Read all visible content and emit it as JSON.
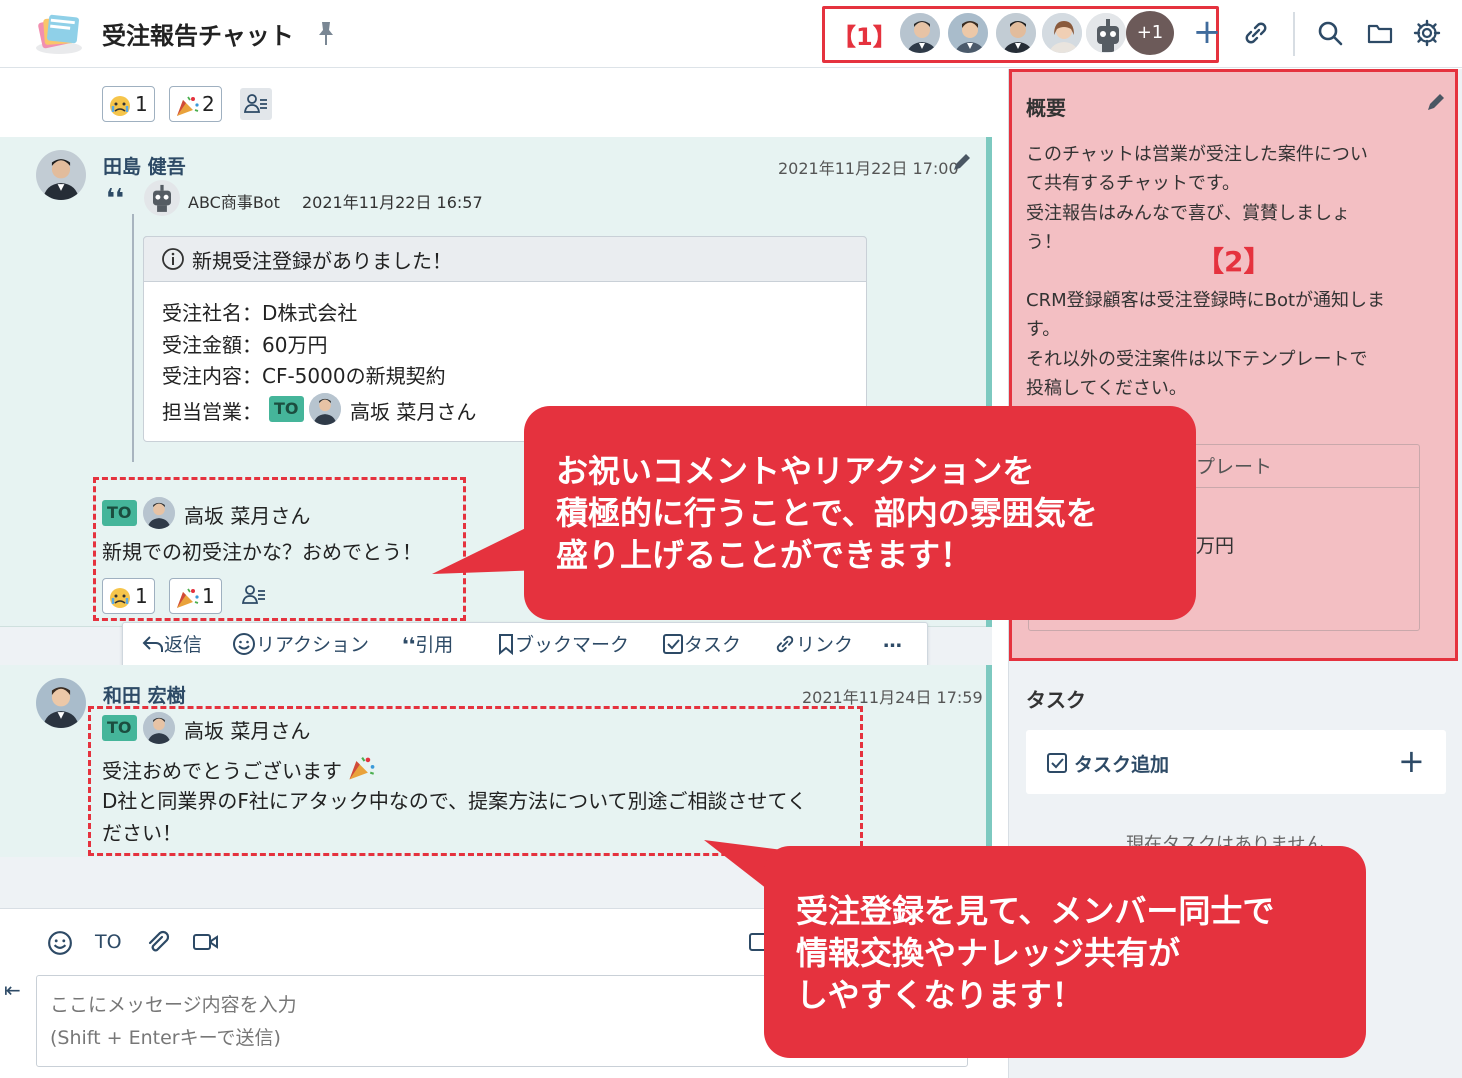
{
  "header": {
    "title": "受注報告チャット",
    "label_marker": "【1】",
    "member_more": "+1",
    "add_member": "+"
  },
  "messages": {
    "top_reactions": [
      {
        "icon": "crying-face-emoji",
        "count": "1"
      },
      {
        "icon": "party-popper-emoji",
        "count": "2"
      }
    ],
    "msg1": {
      "sender": "田島 健吾",
      "timestamp": "2021年11月22日 17:00",
      "quote_mark": "❛❛",
      "quote_author": "ABC商事Bot",
      "quote_time": "2021年11月22日 16:57",
      "card_title": "新規受注登録がありました！",
      "card_lines": [
        "受注社名：D株式会社",
        "受注金額：60万円",
        "受注内容：CF-5000の新規契約"
      ],
      "card_rep_label": "担当営業：",
      "card_rep_name": "高坂 菜月さん",
      "to_label": "TO",
      "reply_to_name": "高坂 菜月さん",
      "text": "新規での初受注かな？おめでとう！",
      "reactions": [
        {
          "icon": "crying-face-emoji",
          "count": "1"
        },
        {
          "icon": "party-popper-emoji",
          "count": "1"
        }
      ]
    },
    "actions": {
      "reply": "返信",
      "reaction": "リアクション",
      "quote": "引用",
      "bookmark": "ブックマーク",
      "task": "タスク",
      "link": "リンク",
      "more": "…"
    },
    "msg2": {
      "sender": "和田 宏樹",
      "timestamp": "2021年11月24日 17:59",
      "to_label": "TO",
      "reply_to_name": "高坂 菜月さん",
      "line1": "受注おめでとうございます",
      "line2": "D社と同業界のF社にアタック中なので、提案方法について別途ご相談させてく",
      "line3": "ださい！"
    }
  },
  "composer": {
    "to_button": "TO",
    "placeholder_line1": "ここにメッセージ内容を入力",
    "placeholder_line2": "(Shift + Enterキーで送信)"
  },
  "sidebar": {
    "description_title": "概要",
    "description_lines": [
      "このチャットは営業が受注した案件につい",
      "て共有するチャットです。",
      "受注報告はみんなで喜び、賞賛しましょ",
      "う！",
      "CRM登録顧客は受注登録時にBotが通知しま",
      "す。",
      "それ以外の受注案件は以下テンプレートで",
      "投稿してください。"
    ],
    "label_marker": "【2】",
    "template_head_partial": "プレート",
    "template_body_partial": "万円",
    "template_body_partial2": "X",
    "task_title": "タスク",
    "task_add": "タスク追加",
    "no_task": "現在タスクはありません"
  },
  "callouts": {
    "callout1": [
      "お祝いコメントやリアクションを",
      "積極的に行うことで、部内の雰囲気を",
      "盛り上げることができます！"
    ],
    "callout2": [
      "受注登録を見て、メンバー同士で",
      "情報交換やナレッジ共有が",
      "しやすくなります！"
    ]
  },
  "colors": {
    "accent_red": "#e5323e",
    "teal_message": "#e7f3f2",
    "to_badge": "#45b59a",
    "link_blue": "#2d4a66"
  }
}
